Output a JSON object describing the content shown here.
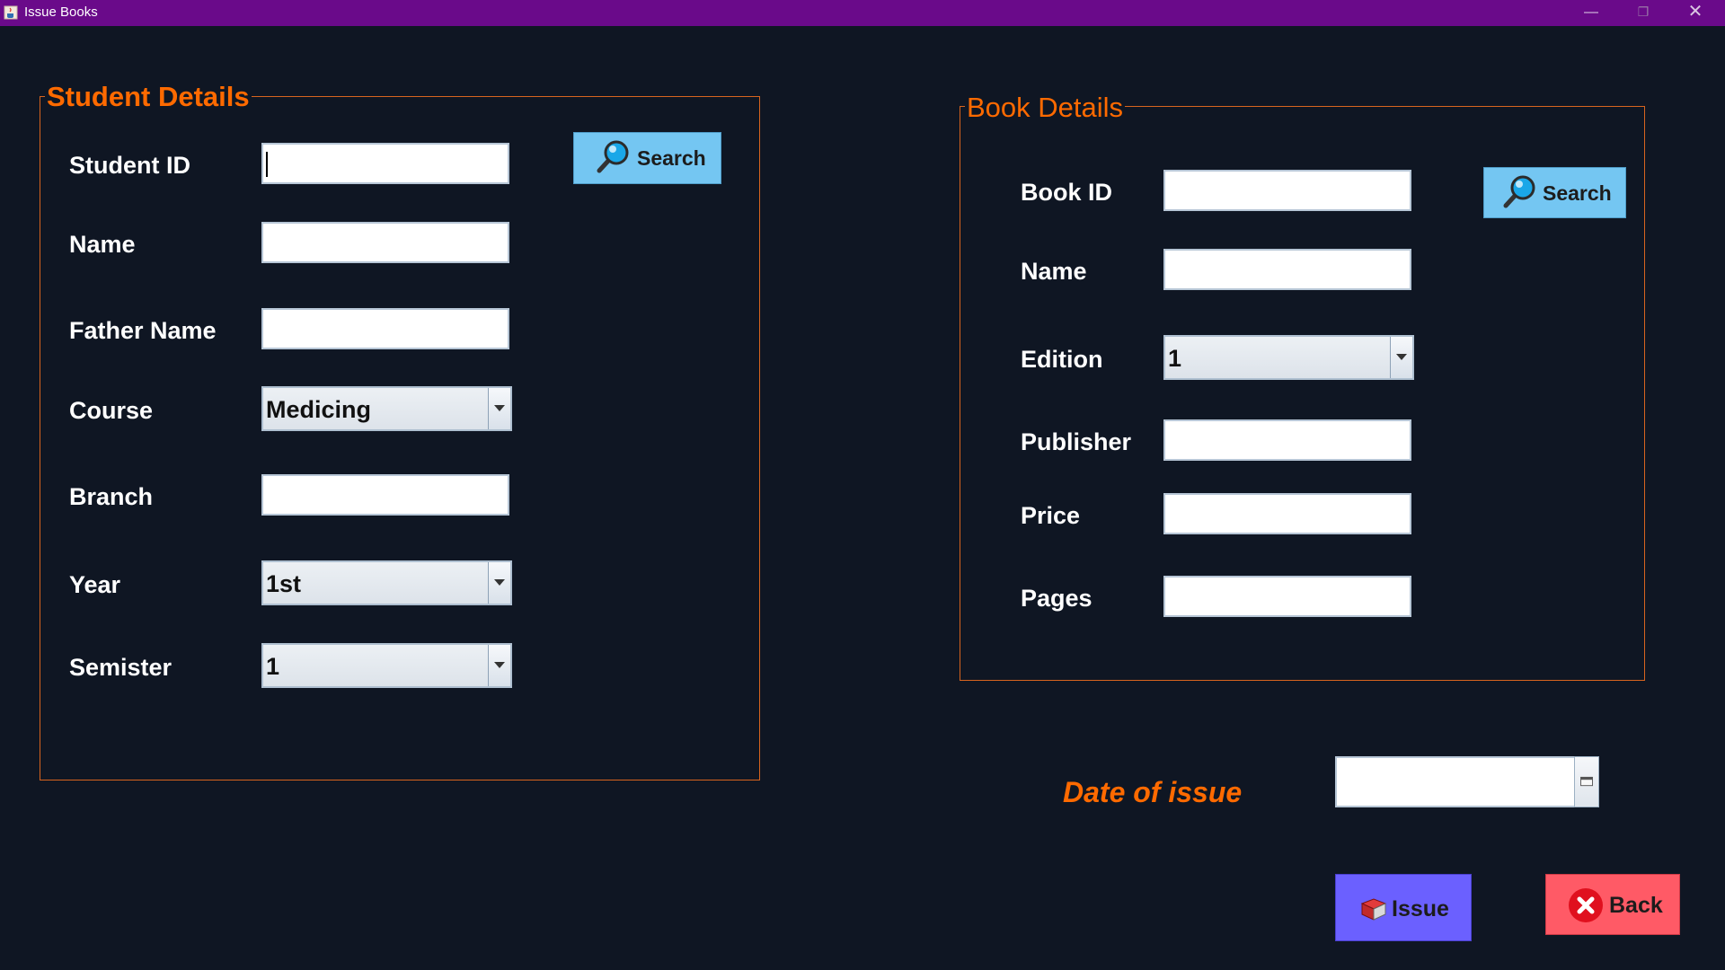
{
  "window": {
    "title": "Issue Books"
  },
  "student_panel": {
    "title": "Student Details",
    "search_label": "Search",
    "fields": {
      "student_id": {
        "label": "Student ID",
        "value": ""
      },
      "name": {
        "label": "Name",
        "value": ""
      },
      "father_name": {
        "label": "Father Name",
        "value": ""
      },
      "course": {
        "label": "Course",
        "selected": "Medicing"
      },
      "branch": {
        "label": "Branch",
        "value": ""
      },
      "year": {
        "label": "Year",
        "selected": "1st"
      },
      "semister": {
        "label": "Semister",
        "selected": "1"
      }
    }
  },
  "book_panel": {
    "title": "Book Details",
    "search_label": "Search",
    "fields": {
      "book_id": {
        "label": "Book ID",
        "value": ""
      },
      "name": {
        "label": "Name",
        "value": ""
      },
      "edition": {
        "label": "Edition",
        "selected": "1"
      },
      "publisher": {
        "label": "Publisher",
        "value": ""
      },
      "price": {
        "label": "Price",
        "value": ""
      },
      "pages": {
        "label": "Pages",
        "value": ""
      }
    }
  },
  "date_of_issue": {
    "label": "Date of issue",
    "value": ""
  },
  "actions": {
    "issue_label": "Issue",
    "back_label": "Back"
  },
  "colors": {
    "titlebar": "#6a0a8a",
    "background": "#0f1623",
    "accent_orange": "#ff6a00",
    "search_button": "#74c6f2",
    "issue_button": "#6b60ff",
    "back_button": "#ff5a66"
  },
  "icons": {
    "app": "java-cup-icon",
    "search": "magnifier-icon",
    "issue": "book-icon",
    "back": "close-circle-icon",
    "date": "calendar-icon"
  }
}
